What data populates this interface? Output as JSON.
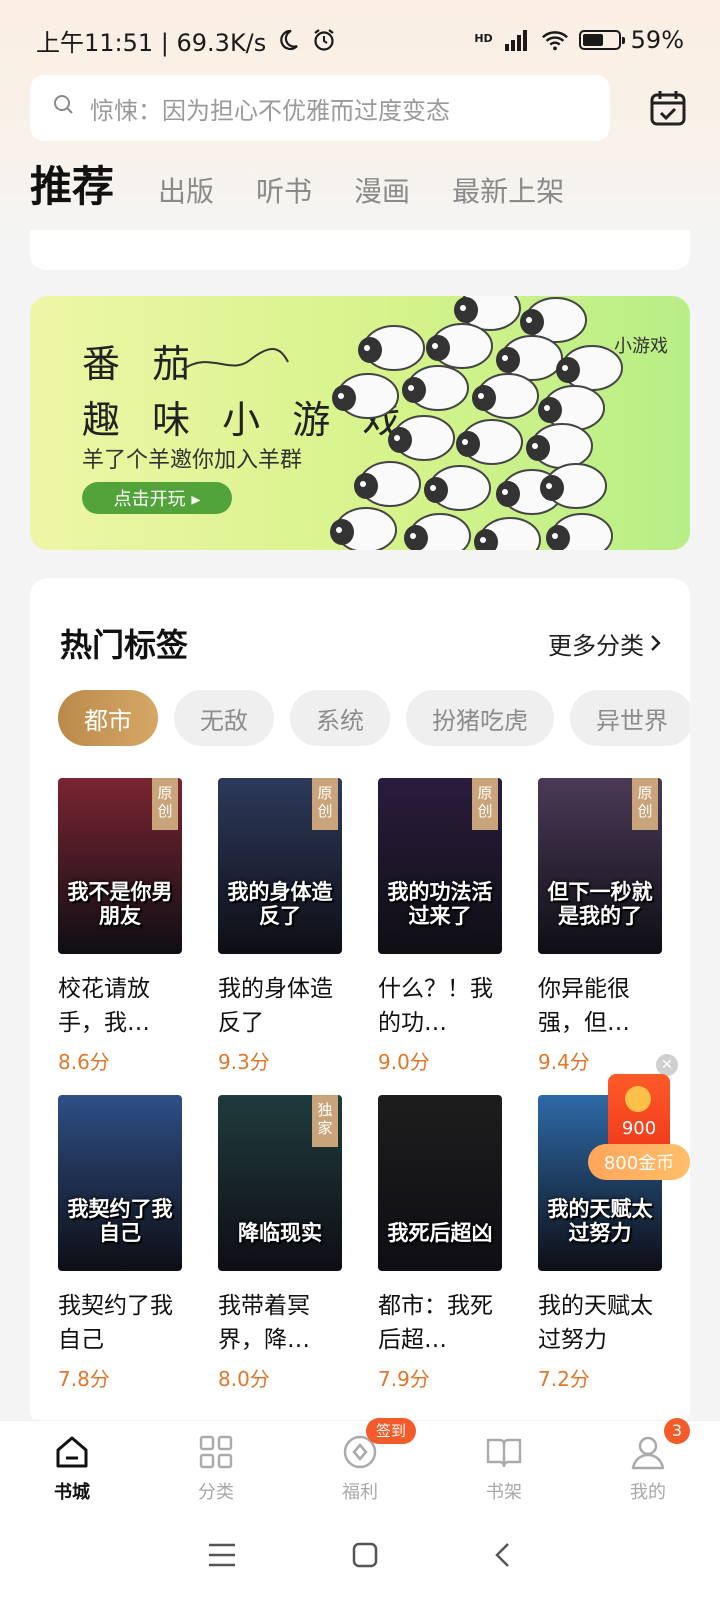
{
  "status_bar": {
    "time": "上午11:51 | 69.3K/s",
    "battery_percent": "59%",
    "battery_level": 0.59,
    "network": "HD"
  },
  "search": {
    "placeholder": "惊悚：因为担心不优雅而过度变态"
  },
  "tabs": [
    {
      "label": "推荐",
      "active": true
    },
    {
      "label": "出版"
    },
    {
      "label": "听书"
    },
    {
      "label": "漫画"
    },
    {
      "label": "最新上架"
    }
  ],
  "banner": {
    "title_line1": "番 茄",
    "title_line2": "趣 味 小 游 戏",
    "subtitle": "羊了个羊邀你加入羊群",
    "button_label": "点击开玩 ▸",
    "tag": "小游戏",
    "colors": {
      "bg_start": "#eef6a6",
      "bg_end": "#b8ee86",
      "button": "#52a43a"
    }
  },
  "hot_tags": {
    "title": "热门标签",
    "more_label": "更多分类",
    "chips": [
      {
        "label": "都市",
        "active": true
      },
      {
        "label": "无敌"
      },
      {
        "label": "系统"
      },
      {
        "label": "扮猪吃虎"
      },
      {
        "label": "异世界"
      }
    ],
    "books": [
      {
        "title": "校花请放手，我…",
        "score": "8.6分",
        "badge": "原创",
        "cover_text": "我不是你男朋友",
        "cover_color": "#7a2530"
      },
      {
        "title": "我的身体造反了",
        "score": "9.3分",
        "badge": "原创",
        "cover_text": "我的身体造反了",
        "cover_color": "#2c3a5a"
      },
      {
        "title": "什么？！我的功…",
        "score": "9.0分",
        "badge": "原创",
        "cover_text": "我的功法活过来了",
        "cover_color": "#2a1d3c"
      },
      {
        "title": "你异能很强，但…",
        "score": "9.4分",
        "badge": "原创",
        "cover_text": "但下一秒就是我的了",
        "cover_color": "#4b3a57"
      },
      {
        "title": "我契约了我自己",
        "score": "7.8分",
        "badge": "",
        "cover_text": "我契约了我自己",
        "cover_color": "#2e4f86"
      },
      {
        "title": "我带着冥界，降…",
        "score": "8.0分",
        "badge": "独家",
        "cover_text": "降临现实",
        "cover_color": "#1f3b3d"
      },
      {
        "title": "都市：我死后超…",
        "score": "7.9分",
        "badge": "",
        "cover_text": "我死后超凶",
        "cover_color": "#1d1d1d"
      },
      {
        "title": "我的天赋太过努力",
        "score": "7.2分",
        "badge": "",
        "cover_text": "我的天赋太过努力",
        "cover_color": "#2d6aa8"
      }
    ]
  },
  "reward": {
    "count": "900",
    "label": "800金币"
  },
  "bottom_nav": [
    {
      "label": "书城",
      "icon": "home-icon",
      "active": true
    },
    {
      "label": "分类",
      "icon": "grid-icon"
    },
    {
      "label": "福利",
      "icon": "coin-icon",
      "badge": "签到"
    },
    {
      "label": "书架",
      "icon": "book-icon"
    },
    {
      "label": "我的",
      "icon": "user-icon",
      "badge": "3"
    }
  ]
}
